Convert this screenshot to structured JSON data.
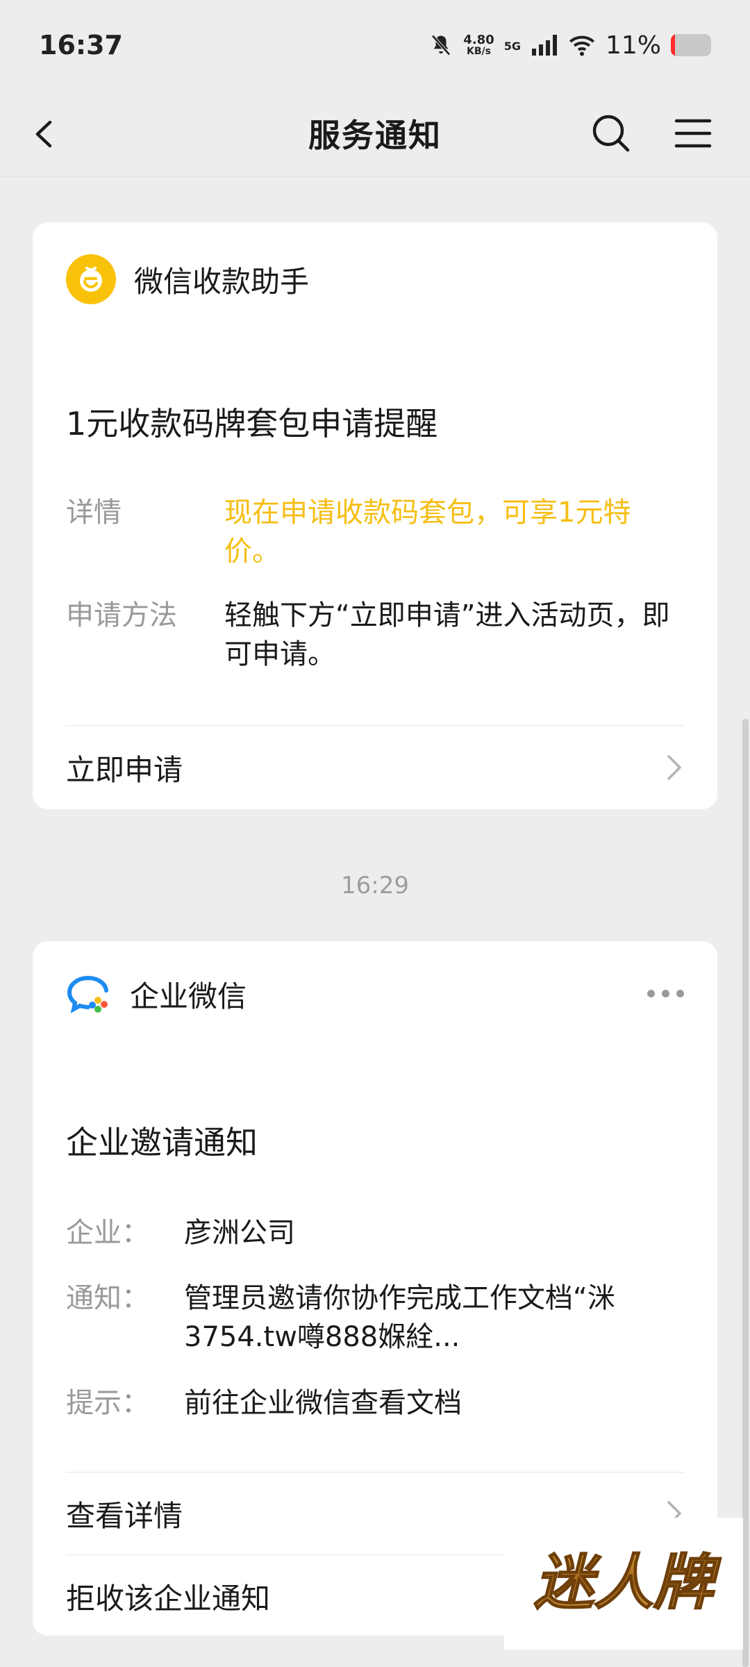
{
  "status_bar": {
    "time": "16:37",
    "net_speed_value": "4.80",
    "net_speed_unit": "KB/s",
    "network": "5G",
    "battery_percent": "11%",
    "battery_level": 0.11
  },
  "nav": {
    "title": "服务通知"
  },
  "messages": [
    {
      "sender": "微信收款助手",
      "title": "1元收款码牌套包申请提醒",
      "fields": [
        {
          "label": "详情",
          "value": "现在申请收款码套包，可享1元特价。"
        },
        {
          "label": "申请方法",
          "value": "轻触下方“立即申请”进入活动页，即可申请。"
        }
      ],
      "actions": [
        {
          "label": "立即申请"
        }
      ]
    },
    {
      "time": "16:29",
      "sender": "企业微信",
      "title": "企业邀请通知",
      "fields": [
        {
          "label": "企业：",
          "value": "彦洲公司"
        },
        {
          "label": "通知：",
          "value": "管理员邀请你协作完成工作文档“洣3754.tw噂888媬絟..."
        },
        {
          "label": "提示：",
          "value": "前往企业微信查看文档"
        }
      ],
      "actions": [
        {
          "label": "查看详情"
        },
        {
          "label": "拒收该企业通知"
        }
      ]
    }
  ],
  "watermark": {
    "text": "迷人牌"
  },
  "colors": {
    "background": "#ededed",
    "card": "#ffffff",
    "highlight": "#f6be14",
    "label": "#999999"
  }
}
